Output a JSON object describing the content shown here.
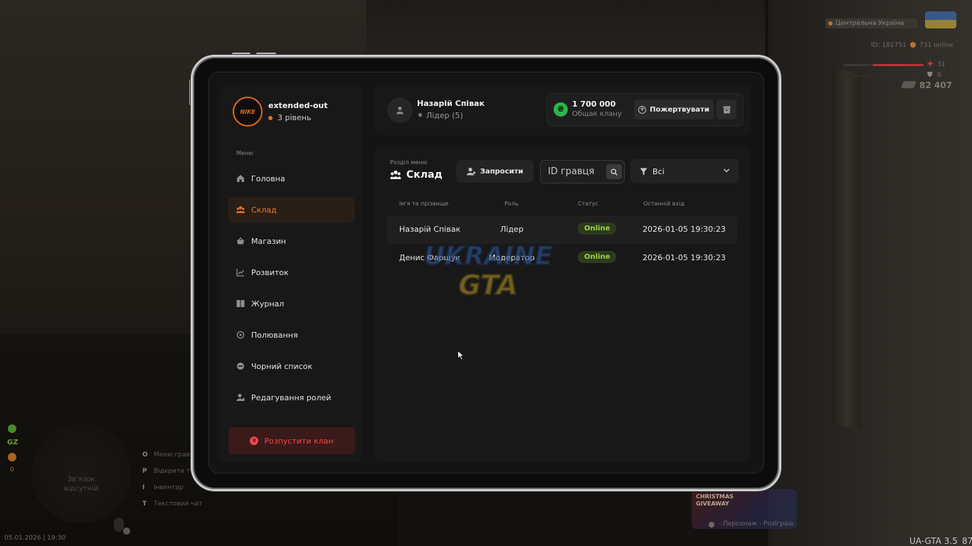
{
  "hud": {
    "region": "Центральна Україна",
    "player_id": "ID: 181751",
    "online": "731 online",
    "health": "31",
    "armor": "0",
    "money": "82 407",
    "gz_label": "GZ",
    "zero_label": "0",
    "minimap_text_1": "Зв'язок",
    "minimap_text_2": "відсутній",
    "date_time": "05.01.2026 | 19:30",
    "server": "UA-GTA 3.5",
    "fps": "87",
    "tips": [
      {
        "key": "O",
        "label": "Меню гравця"
      },
      {
        "key": "P",
        "label": "Відкрити телефон"
      },
      {
        "key": "I",
        "label": "Інвентар"
      },
      {
        "key": "T",
        "label": "Текстовий чат"
      }
    ],
    "promo_title_1": "CHRISTMAS",
    "promo_title_2": "GIVEAWAY",
    "promo_footer": "- Персонаж - Розіграш",
    "colors": {
      "health": "#c33a3a",
      "accent": "#e86b1c"
    }
  },
  "clan": {
    "logo_text": "NIKE",
    "name": "extended-out",
    "level": "3 рівень"
  },
  "sidebar": {
    "caption": "Меню",
    "items": [
      {
        "label": "Головна",
        "icon": "home-icon"
      },
      {
        "label": "Склад",
        "icon": "warehouse-icon",
        "active": true
      },
      {
        "label": "Магазин",
        "icon": "basket-icon"
      },
      {
        "label": "Розвиток",
        "icon": "chart-icon"
      },
      {
        "label": "Журнал",
        "icon": "book-icon"
      },
      {
        "label": "Полювання",
        "icon": "target-icon"
      },
      {
        "label": "Чорний список",
        "icon": "block-icon"
      },
      {
        "label": "Редагування ролей",
        "icon": "user-edit-icon"
      }
    ],
    "disband_label": "Розпустити клан"
  },
  "leader": {
    "name": "Назарій Співак",
    "role": "Лідер (5)"
  },
  "bank": {
    "currency_symbol": "₴",
    "amount": "1 700 000",
    "label": "Общак клану",
    "donate_label": "Пожертвувати"
  },
  "section": {
    "caption": "Розділ меню",
    "title": "Склад",
    "invite_label": "Запросити",
    "search_placeholder": "ID гравця",
    "filter_value": "Всі"
  },
  "table": {
    "headers": [
      "Ім'я та прізвище",
      "Роль",
      "Статус",
      "Останній вхід"
    ],
    "rows": [
      {
        "name": "Назарій Співак",
        "role": "Лідер",
        "status": "Online",
        "last": "2026-01-05 19:30:23"
      },
      {
        "name": "Денис Фарщук",
        "role": "Модератор",
        "status": "Online",
        "last": "2026-01-05 19:30:23"
      }
    ]
  },
  "watermark": {
    "line1": "UKRAINE",
    "line2": "GTA"
  }
}
